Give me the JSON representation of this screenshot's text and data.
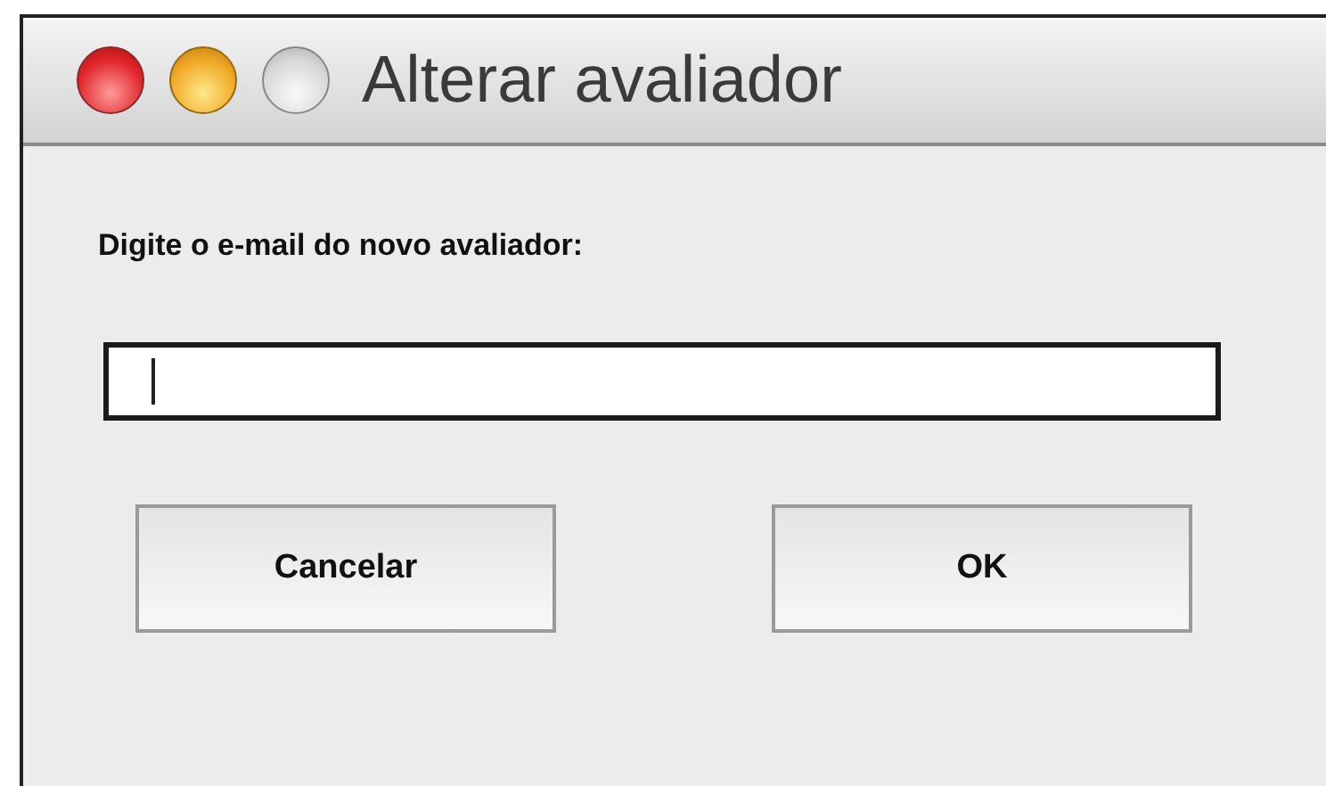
{
  "window": {
    "title": "Alterar avaliador"
  },
  "prompt": "Digite o e-mail do novo avaliador:",
  "email_field": {
    "focused": true
  },
  "buttons": [
    {
      "label": "Cancelar"
    },
    {
      "label": "OK"
    }
  ]
}
